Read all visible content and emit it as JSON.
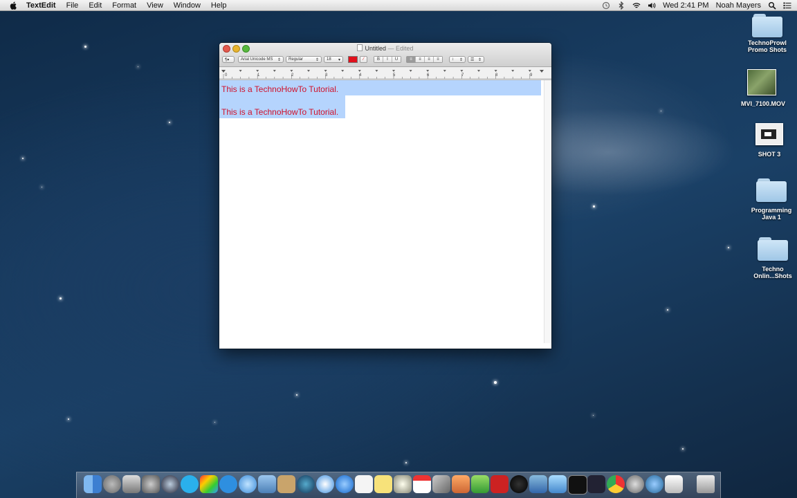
{
  "menubar": {
    "app_name": "TextEdit",
    "menus": [
      "File",
      "Edit",
      "Format",
      "View",
      "Window",
      "Help"
    ],
    "clock": "Wed 2:41 PM",
    "user": "Noah Mayers"
  },
  "window": {
    "title": "Untitled",
    "status": "— Edited",
    "font_family": "Arial Unicode MS",
    "font_style": "Regular",
    "font_size": "18",
    "text_color": "#e0101c",
    "style_buttons": [
      "B",
      "I",
      "U"
    ],
    "ruler_numbers": [
      "0",
      "1",
      "2",
      "3",
      "4",
      "5",
      "6",
      "7",
      "8",
      "9"
    ],
    "lines": [
      "This is a TechnoHowTo Tutorial.",
      "This is a TechnoHowTo Tutorial."
    ]
  },
  "desktop": {
    "icons": [
      {
        "label": "TechnoProwl Promo Shots",
        "kind": "folder"
      },
      {
        "label": "MVI_7100.MOV",
        "kind": "video"
      },
      {
        "label": "SHOT 3",
        "kind": "screenshot"
      },
      {
        "label": "Programming Java 1",
        "kind": "folder"
      },
      {
        "label": "Techno Onlin...Shots",
        "kind": "folder"
      }
    ]
  },
  "dock": {
    "apps": [
      "finder",
      "launchpad",
      "dashboard",
      "system-preferences",
      "quicktime",
      "skype",
      "photo-booth",
      "app-store",
      "messages",
      "preview",
      "contacts",
      "google-earth",
      "safari",
      "itunes",
      "textedit",
      "stickies",
      "imovie",
      "calendar",
      "pen",
      "keynote",
      "numbers",
      "photo",
      "camera",
      "maps",
      "network",
      "terminal",
      "kindle",
      "chrome",
      "utility",
      "downloads",
      "documents",
      "trash"
    ]
  }
}
